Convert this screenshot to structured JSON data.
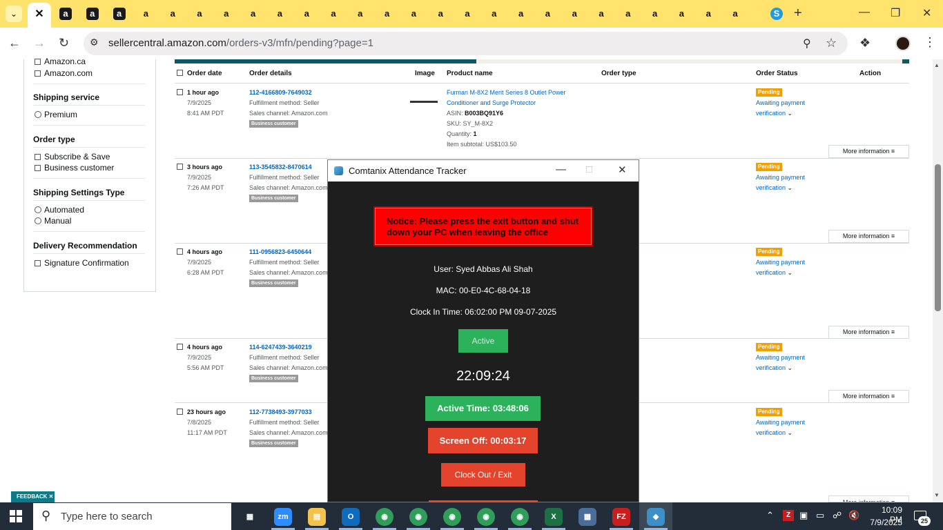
{
  "browser": {
    "tab_favicons": [
      "amazon-dark",
      "amazon-dark",
      "amazon-dark",
      "amazon-light",
      "amazon-light",
      "amazon-light",
      "amazon-light",
      "amazon-light",
      "amazon-light",
      "amazon-light",
      "amazon-light",
      "amazon-light",
      "amazon-light",
      "amazon-light",
      "amazon-light",
      "amazon-light",
      "amazon-light",
      "amazon-light",
      "amazon-light",
      "amazon-light",
      "amazon-light",
      "amazon-light",
      "amazon-light",
      "amazon-light",
      "amazon-light",
      "amazon-light",
      "skype"
    ],
    "url_domain": "sellercentral.amazon.com",
    "url_path": "/orders-v3/mfn/pending?page=1"
  },
  "filters": {
    "marketplaces": [
      "Amazon.ca",
      "Amazon.com"
    ],
    "shipping_service_title": "Shipping service",
    "shipping_service_options": [
      "Premium"
    ],
    "order_type_title": "Order type",
    "order_type_options": [
      "Subscribe & Save",
      "Business customer"
    ],
    "shipping_settings_title": "Shipping Settings Type",
    "shipping_settings_options": [
      "Automated",
      "Manual"
    ],
    "delivery_title": "Delivery Recommendation",
    "delivery_options": [
      "Signature Confirmation"
    ]
  },
  "table": {
    "headers": {
      "order_date": "Order date",
      "order_details": "Order details",
      "image": "Image",
      "product_name": "Product name",
      "order_type": "Order type",
      "order_status": "Order Status",
      "action": "Action"
    },
    "fulfillment": "Fulfillment method: Seller",
    "sales_channel": "Sales channel: Amazon.com",
    "business_badge": "Business customer",
    "pending_badge": "Pending",
    "status_line1": "Awaiting payment",
    "status_line2": "verification",
    "more_info": "More information",
    "orders": [
      {
        "age": "1 hour ago",
        "date": "7/9/2025",
        "time": "8:41 AM PDT",
        "order_id": "112-4166809-7649032"
      },
      {
        "age": "3 hours ago",
        "date": "7/9/2025",
        "time": "7:26 AM PDT",
        "order_id": "113-3545832-8470614"
      },
      {
        "age": "4 hours ago",
        "date": "7/9/2025",
        "time": "6:28 AM PDT",
        "order_id": "111-0956823-6450644"
      },
      {
        "age": "4 hours ago",
        "date": "7/9/2025",
        "time": "5:56 AM PDT",
        "order_id": "114-6247439-3640219"
      },
      {
        "age": "23 hours ago",
        "date": "7/8/2025",
        "time": "11:17 AM PDT",
        "order_id": "112-7738493-3977033"
      }
    ],
    "product": {
      "name_line1": "Furman M-8X2 Merit Series 8 Outlet Power",
      "name_line2": "Conditioner and Surge Protector",
      "asin_label": "ASIN:",
      "asin": "B003BQ91Y6",
      "sku": "SKU: SY_M-8X2",
      "quantity_label": "Quantity:",
      "quantity": "1",
      "subtotal": "Item subtotal: US$103.50"
    }
  },
  "feedback_label": "FEEDBACK",
  "tracker": {
    "title": "Comtanix Attendance Tracker",
    "notice": "Notice: Please press the exit button and shut down your PC when leaving the office",
    "user": "User: Syed  Abbas Ali Shah",
    "mac": "MAC: 00-E0-4C-68-04-18",
    "clock_in": "Clock In Time: 06:02:00 PM 09-07-2025",
    "status_button": "Active",
    "clock": "22:09:24",
    "active_time": "Active Time: 03:48:06",
    "screen_off": "Screen Off: 00:03:17",
    "clock_out": "Clock Out / Exit",
    "colors": {
      "green": "#2bb25a",
      "red": "#e4432c",
      "notice_red": "#ff0000",
      "background": "#1e1e1e"
    }
  },
  "taskbar": {
    "search_placeholder": "Type here to search",
    "apps": [
      "task-view",
      "zoom",
      "file-explorer",
      "outlook",
      "chrome",
      "chrome",
      "chrome",
      "chrome",
      "chrome",
      "excel",
      "calculator",
      "filezilla",
      "attendance-tracker"
    ],
    "time": "10:09 PM",
    "date": "7/9/2025",
    "notifications": "25"
  }
}
